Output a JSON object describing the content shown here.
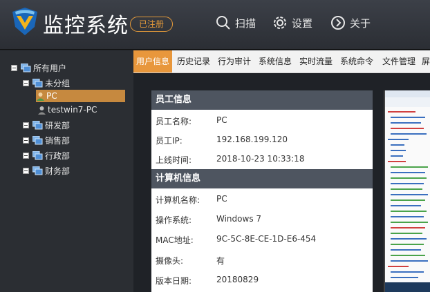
{
  "app": {
    "title": "监控系统",
    "register_badge": "已注册"
  },
  "header_nav": [
    {
      "label": "扫描",
      "icon": "search-icon"
    },
    {
      "label": "设置",
      "icon": "gear-icon"
    },
    {
      "label": "关于",
      "icon": "chevron-right-circle-icon"
    }
  ],
  "tree": {
    "root": "所有用户",
    "groups": [
      {
        "label": "未分组"
      },
      {
        "label": "研发部"
      },
      {
        "label": "销售部"
      },
      {
        "label": "行政部"
      },
      {
        "label": "财务部"
      }
    ],
    "users": [
      {
        "label": "PC",
        "selected": true
      },
      {
        "label": "testwin7-PC",
        "selected": false
      }
    ]
  },
  "tabs": [
    {
      "label": "用户信息",
      "active": true
    },
    {
      "label": "历史记录"
    },
    {
      "label": "行为审计"
    },
    {
      "label": "系统信息"
    },
    {
      "label": "实时流量"
    },
    {
      "label": "系统命令"
    },
    {
      "label": "文件管理"
    },
    {
      "label": "屏"
    }
  ],
  "employee": {
    "section_title": "员工信息",
    "rows": [
      {
        "label": "员工名称:",
        "value": "PC"
      },
      {
        "label": "员工IP:",
        "value": "192.168.199.120"
      },
      {
        "label": "上线时间:",
        "value": "2018-10-23 10:33:18"
      }
    ]
  },
  "computer": {
    "section_title": "计算机信息",
    "rows": [
      {
        "label": "计算机名称:",
        "value": "PC"
      },
      {
        "label": "操作系统:",
        "value": "Windows 7"
      },
      {
        "label": "MAC地址:",
        "value": "9C-5C-8E-CE-1D-E6-454"
      },
      {
        "label": "摄像头:",
        "value": "有"
      },
      {
        "label": "版本日期:",
        "value": "20180829"
      }
    ]
  },
  "colors": {
    "accent": "#e8973c",
    "header_bg": "#2b2e34",
    "section_bg": "#4e5560"
  }
}
